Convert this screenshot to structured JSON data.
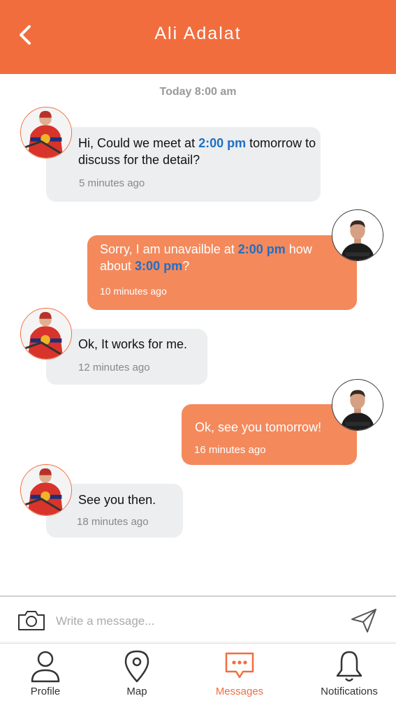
{
  "header": {
    "title": "Ali Adalat"
  },
  "date_separator": "Today 8:00 am",
  "messages": [
    {
      "direction": "incoming",
      "text_before": "Hi,  Could we meet at ",
      "highlight": "2:00 pm",
      "text_after": " tomorrow to discuss for the detail?",
      "time": "5 minutes ago"
    },
    {
      "direction": "outgoing",
      "text_before": "Sorry, I am unavailble at ",
      "highlight": "2:00 pm",
      "text_middle": " how about ",
      "highlight2": "3:00 pm",
      "text_after": "?",
      "time": "10 minutes ago"
    },
    {
      "direction": "incoming",
      "text": "Ok, It works for me.",
      "time": "12 minutes ago"
    },
    {
      "direction": "outgoing",
      "text": "Ok, see you tomorrow!",
      "time": "16 minutes ago"
    },
    {
      "direction": "incoming",
      "text": "See you then.",
      "time": "18 minutes ago"
    }
  ],
  "composer": {
    "placeholder": "Write a message...",
    "value": ""
  },
  "tabs": [
    {
      "label": "Profile",
      "icon": "person-icon",
      "active": false
    },
    {
      "label": "Map",
      "icon": "map-pin-icon",
      "active": false
    },
    {
      "label": "Messages",
      "icon": "chat-bubble-icon",
      "active": true
    },
    {
      "label": "Notifications",
      "icon": "bell-icon",
      "active": false
    }
  ],
  "colors": {
    "accent": "#f26d3d",
    "outgoing_bubble": "#f4895c",
    "incoming_bubble": "#eceef0",
    "highlight": "#1f6fc5"
  }
}
